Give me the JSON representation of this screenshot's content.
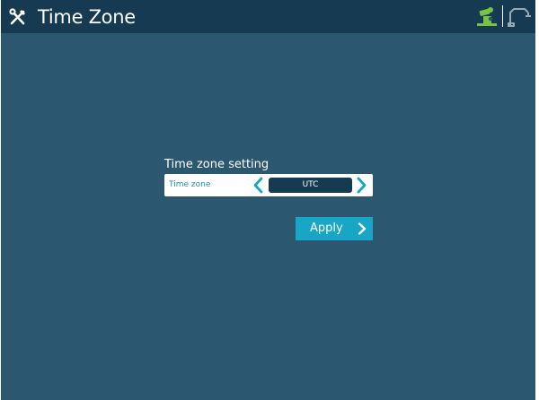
{
  "header": {
    "title": "Time Zone",
    "left_icon": "tools-icon",
    "status_icon": "robot-status-icon",
    "robot_icon": "robot-arm-icon"
  },
  "time_zone_section": {
    "label": "Time zone setting",
    "field_label": "Time zone",
    "value": "UTC",
    "prev_icon": "chevron-left-icon",
    "next_icon": "chevron-right-icon"
  },
  "apply_button": {
    "label": "Apply",
    "icon": "chevron-right-icon"
  },
  "colors": {
    "background": "#2b5770",
    "header": "#163a51",
    "accent": "#17a6c5",
    "status_green": "#7bc242",
    "field_text": "#1f8fb3"
  }
}
